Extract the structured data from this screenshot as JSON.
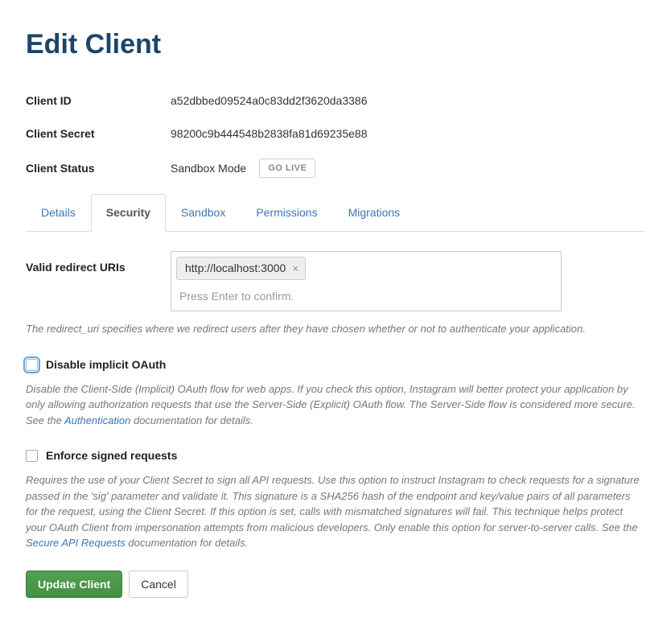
{
  "page_title": "Edit Client",
  "info": {
    "client_id_label": "Client ID",
    "client_id_value": "a52dbbed09524a0c83dd2f3620da3386",
    "client_secret_label": "Client Secret",
    "client_secret_value": "98200c9b444548b2838fa81d69235e88",
    "client_status_label": "Client Status",
    "client_status_value": "Sandbox Mode",
    "go_live_label": "GO LIVE"
  },
  "tabs": {
    "details": "Details",
    "security": "Security",
    "sandbox": "Sandbox",
    "permissions": "Permissions",
    "migrations": "Migrations"
  },
  "form": {
    "redirect_label": "Valid redirect URIs",
    "redirect_tag": "http://localhost:3000",
    "redirect_placeholder": "Press Enter to confirm.",
    "redirect_help": "The redirect_uri specifies where we redirect users after they have chosen whether or not to authenticate your application.",
    "disable_oauth_label": "Disable implicit OAuth",
    "disable_oauth_help_pre": "Disable the Client-Side (Implicit) OAuth flow for web apps. If you check this option, Instagram will better protect your application by only allowing authorization requests that use the Server-Side (Explicit) OAuth flow. The Server-Side flow is considered more secure. See the ",
    "authentication_link": "Authentication",
    "disable_oauth_help_post": " documentation for details.",
    "enforce_signed_label": "Enforce signed requests",
    "enforce_signed_help_pre": "Requires the use of your Client Secret to sign all API requests. Use this option to instruct Instagram to check requests for a signature passed in the 'sig' parameter and validate it. This signature is a SHA256 hash of the endpoint and key/value pairs of all parameters for the request, using the Client Secret. If this option is set, calls with mismatched signatures will fail. This technique helps protect your OAuth Client from impersonation attempts from malicious developers. Only enable this option for server-to-server calls. See the ",
    "secure_api_link": "Secure API Requests",
    "enforce_signed_help_post": " documentation for details."
  },
  "buttons": {
    "update": "Update Client",
    "cancel": "Cancel"
  }
}
